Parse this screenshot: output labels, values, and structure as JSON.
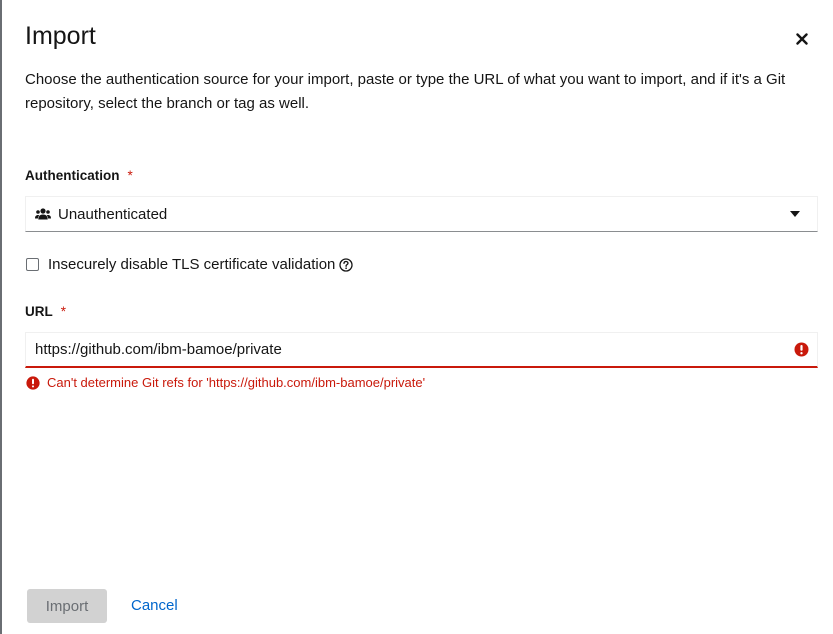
{
  "modal": {
    "title": "Import",
    "description": "Choose the authentication source for your import, paste or type the URL of what you want to import, and if it's a Git repository, select the branch or tag as well."
  },
  "authentication": {
    "label": "Authentication",
    "required_marker": "*",
    "selected_value": "Unauthenticated",
    "icon": "users-icon"
  },
  "tls": {
    "label": "Insecurely disable TLS certificate validation",
    "checked": false,
    "icon": "help-icon"
  },
  "url": {
    "label": "URL",
    "required_marker": "*",
    "value": "https://github.com/ibm-bamoe/private",
    "error_message": "Can't determine Git refs for 'https://github.com/ibm-bamoe/private'"
  },
  "footer": {
    "import_label": "Import",
    "cancel_label": "Cancel"
  },
  "colors": {
    "error": "#c9190b",
    "link": "#0066cc",
    "disabled_bg": "#d2d2d2"
  }
}
